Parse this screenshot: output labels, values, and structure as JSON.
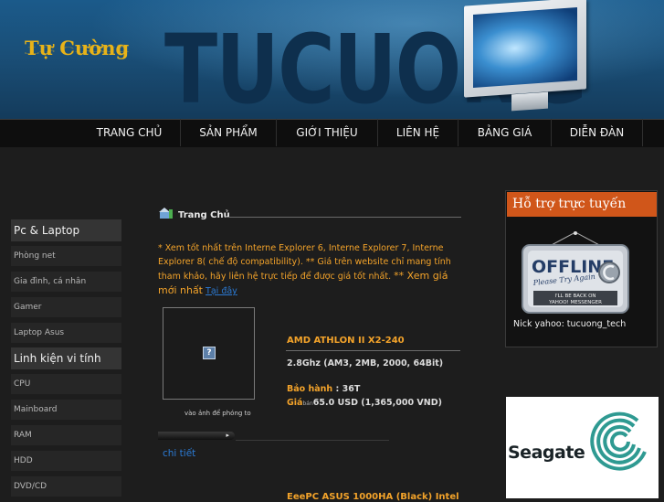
{
  "header": {
    "logo_text": "Tự Cường",
    "watermark_text": "TUCUONG"
  },
  "nav": {
    "items": [
      "TRANG CHỦ",
      "SẢN PHẨM",
      "GIỚI THIỆU",
      "LIÊN HỆ",
      "BẢNG GIÁ",
      "DIỄN ĐÀN"
    ]
  },
  "sidebar": {
    "categories": [
      {
        "label": "Pc & Laptop",
        "items": [
          "Phòng net",
          "Gia đình, cá nhân",
          "Gamer",
          "Laptop Asus"
        ]
      },
      {
        "label": "Linh kiện vi tính",
        "items": [
          "CPU",
          "Mainboard",
          "RAM",
          "HDD",
          "DVD/CD"
        ]
      }
    ]
  },
  "main": {
    "breadcrumb": "Trang Chủ",
    "notice": {
      "line1": "* Xem tốt nhất trên Interne Explorer 6, Interne Explorer 7, Interne Explorer 8( chế độ compatibility). ** Giá trên website chỉ mang tính tham khảo, hãy liên hệ trực tiếp để được giá tốt nhất.",
      "line2": "** Xem giá mới nhất",
      "link": "Tại đây"
    },
    "product": {
      "image_caption": "vào ảnh để phóng to",
      "name": "AMD ATHLON II X2-240",
      "spec": "2.8Ghz (AM3, 2MB, 2000, 64Bit)",
      "warranty_label": "Bảo hành",
      "warranty_value": ": 36T",
      "price_label": "Giá",
      "price_small": "bán",
      "price_value": "65.0 USD (1,365,000 VND)",
      "detail_link": "chi tiết",
      "scroll_label": "▸"
    },
    "next_product_name": "EeePC ASUS 1000HA (Black) Intel"
  },
  "support": {
    "title": "Hỗ trợ trực tuyến",
    "offline_main": "OFFLINE",
    "offline_sub": "Please Try Again",
    "offline_back1": "I'LL BE BACK ON",
    "offline_back2": "YAHOO! MESSENGER",
    "nick": "Nick yahoo: tucuong_tech"
  },
  "ad": {
    "brand": "Seagate"
  },
  "colors": {
    "accent_orange": "#f3a32a",
    "support_header": "#d0561a",
    "link_blue": "#2b7ad4",
    "logo_gold": "#e8b319"
  }
}
